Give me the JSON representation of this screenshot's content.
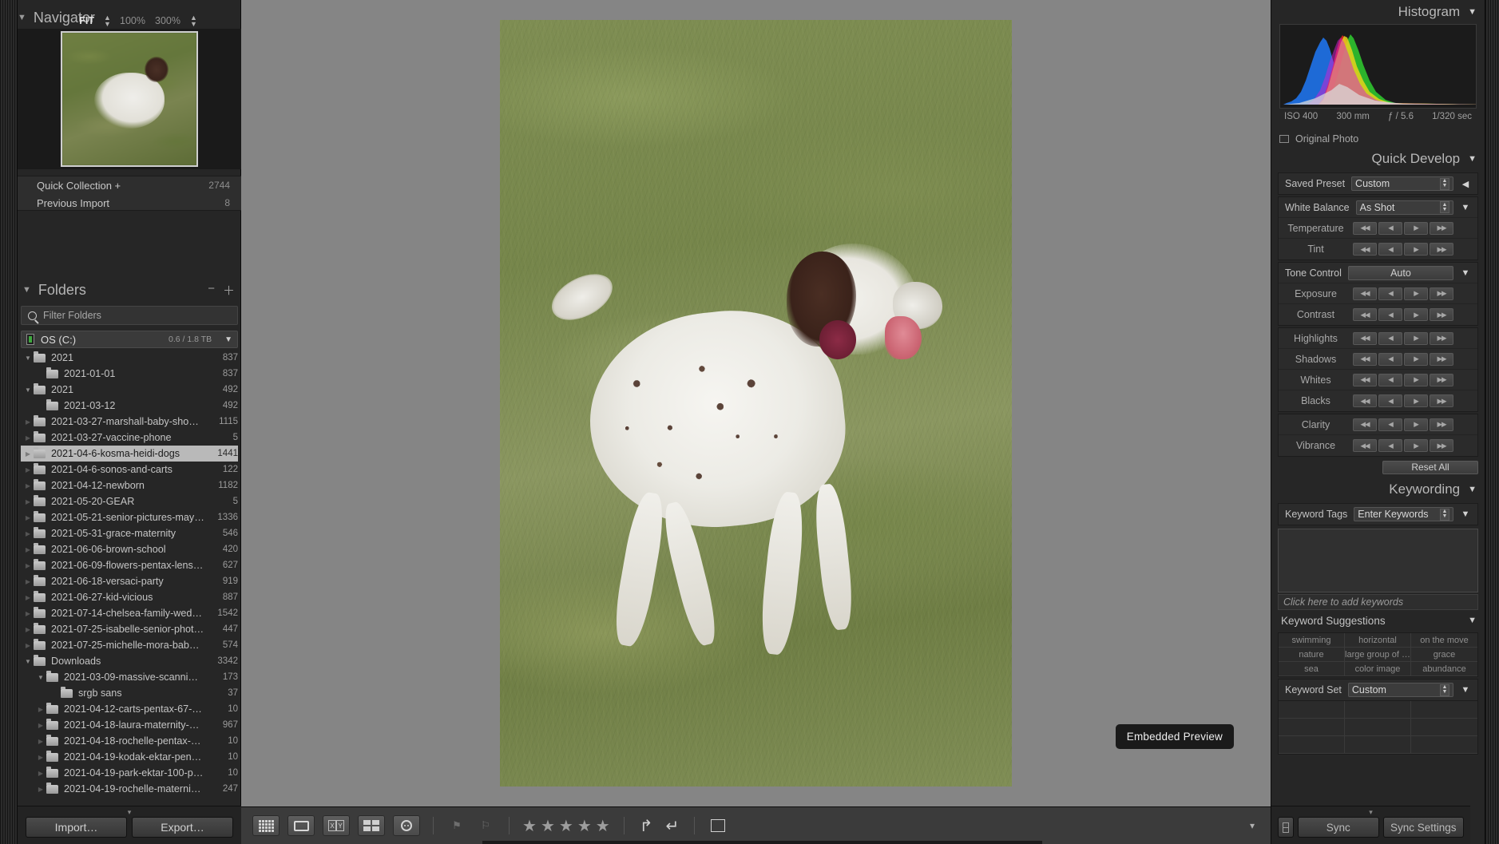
{
  "navigator": {
    "title": "Navigator",
    "fit_label": "FIT",
    "zoom_100": "100%",
    "zoom_300": "300%"
  },
  "collections": [
    {
      "name": "Quick Collection  +",
      "count": "2744"
    },
    {
      "name": "Previous Import",
      "count": "8"
    }
  ],
  "folders_panel": {
    "title": "Folders",
    "filter_placeholder": "Filter Folders",
    "volume_name": "OS (C:)",
    "volume_space": "0.6 / 1.8 TB"
  },
  "folders": [
    {
      "name": "2021",
      "count": "837",
      "indent": 0,
      "disc": "open"
    },
    {
      "name": "2021-01-01",
      "count": "837",
      "indent": 1,
      "disc": "leaf"
    },
    {
      "name": "2021",
      "count": "492",
      "indent": 0,
      "disc": "open"
    },
    {
      "name": "2021-03-12",
      "count": "492",
      "indent": 1,
      "disc": "leaf"
    },
    {
      "name": "2021-03-27-marshall-baby-sho…",
      "count": "1115",
      "indent": 0,
      "disc": "closed"
    },
    {
      "name": "2021-03-27-vaccine-phone",
      "count": "5",
      "indent": 0,
      "disc": "closed"
    },
    {
      "name": "2021-04-6-kosma-heidi-dogs",
      "count": "1441",
      "indent": 0,
      "disc": "closed",
      "selected": true
    },
    {
      "name": "2021-04-6-sonos-and-carts",
      "count": "122",
      "indent": 0,
      "disc": "closed"
    },
    {
      "name": "2021-04-12-newborn",
      "count": "1182",
      "indent": 0,
      "disc": "closed"
    },
    {
      "name": "2021-05-20-GEAR",
      "count": "5",
      "indent": 0,
      "disc": "closed"
    },
    {
      "name": "2021-05-21-senior-pictures-may…",
      "count": "1336",
      "indent": 0,
      "disc": "closed"
    },
    {
      "name": "2021-05-31-grace-maternity",
      "count": "546",
      "indent": 0,
      "disc": "closed"
    },
    {
      "name": "2021-06-06-brown-school",
      "count": "420",
      "indent": 0,
      "disc": "closed"
    },
    {
      "name": "2021-06-09-flowers-pentax-lens…",
      "count": "627",
      "indent": 0,
      "disc": "closed"
    },
    {
      "name": "2021-06-18-versaci-party",
      "count": "919",
      "indent": 0,
      "disc": "closed"
    },
    {
      "name": "2021-06-27-kid-vicious",
      "count": "887",
      "indent": 0,
      "disc": "closed"
    },
    {
      "name": "2021-07-14-chelsea-family-wed…",
      "count": "1542",
      "indent": 0,
      "disc": "closed"
    },
    {
      "name": "2021-07-25-isabelle-senior-phot…",
      "count": "447",
      "indent": 0,
      "disc": "closed"
    },
    {
      "name": "2021-07-25-michelle-mora-bab…",
      "count": "574",
      "indent": 0,
      "disc": "closed"
    },
    {
      "name": "Downloads",
      "count": "3342",
      "indent": 0,
      "disc": "open"
    },
    {
      "name": "2021-03-09-massive-scanni…",
      "count": "173",
      "indent": 1,
      "disc": "open"
    },
    {
      "name": "srgb sans",
      "count": "37",
      "indent": 2,
      "disc": "leaf"
    },
    {
      "name": "2021-04-12-carts-pentax-67-…",
      "count": "10",
      "indent": 1,
      "disc": "closed"
    },
    {
      "name": "2021-04-18-laura-maternity-…",
      "count": "967",
      "indent": 1,
      "disc": "closed"
    },
    {
      "name": "2021-04-18-rochelle-pentax-…",
      "count": "10",
      "indent": 1,
      "disc": "closed"
    },
    {
      "name": "2021-04-19-kodak-ektar-pen…",
      "count": "10",
      "indent": 1,
      "disc": "closed"
    },
    {
      "name": "2021-04-19-park-ektar-100-p…",
      "count": "10",
      "indent": 1,
      "disc": "closed"
    },
    {
      "name": "2021-04-19-rochelle-materni…",
      "count": "247",
      "indent": 1,
      "disc": "closed"
    }
  ],
  "left_bottom": {
    "import_label": "Import…",
    "export_label": "Export…"
  },
  "canvas": {
    "embedded_preview_badge": "Embedded Preview"
  },
  "toolbar": {
    "icons": [
      "grid-view-icon",
      "loupe-view-icon",
      "compare-view-icon",
      "survey-view-icon",
      "people-view-icon",
      "flag-pick-icon",
      "flag-reject-icon",
      "rotate-left-icon",
      "rotate-right-icon",
      "crop-overlay-icon"
    ],
    "star_count": 5,
    "chevron": "▾"
  },
  "histogram": {
    "title": "Histogram",
    "iso": "ISO 400",
    "focal": "300 mm",
    "aperture": "ƒ / 5.6",
    "shutter": "1/320 sec",
    "original_photo_label": "Original Photo"
  },
  "quick_develop": {
    "title": "Quick Develop",
    "saved_preset_label": "Saved Preset",
    "saved_preset_value": "Custom",
    "white_balance_label": "White Balance",
    "white_balance_value": "As Shot",
    "temperature_label": "Temperature",
    "tint_label": "Tint",
    "tone_control_label": "Tone Control",
    "auto_label": "Auto",
    "exposure_label": "Exposure",
    "contrast_label": "Contrast",
    "highlights_label": "Highlights",
    "shadows_label": "Shadows",
    "whites_label": "Whites",
    "blacks_label": "Blacks",
    "clarity_label": "Clarity",
    "vibrance_label": "Vibrance",
    "reset_all_label": "Reset All"
  },
  "keywording": {
    "title": "Keywording",
    "keyword_tags_label": "Keyword Tags",
    "keyword_tags_value": "Enter Keywords",
    "add_keywords_placeholder": "Click here to add keywords",
    "suggestions_title": "Keyword Suggestions",
    "suggestions": [
      "swimming",
      "horizontal",
      "on the move",
      "nature",
      "large group of …",
      "grace",
      "sea",
      "color image",
      "abundance"
    ],
    "keyword_set_label": "Keyword Set",
    "keyword_set_value": "Custom"
  },
  "right_bottom": {
    "sync_label": "Sync",
    "sync_settings_label": "Sync Settings"
  }
}
